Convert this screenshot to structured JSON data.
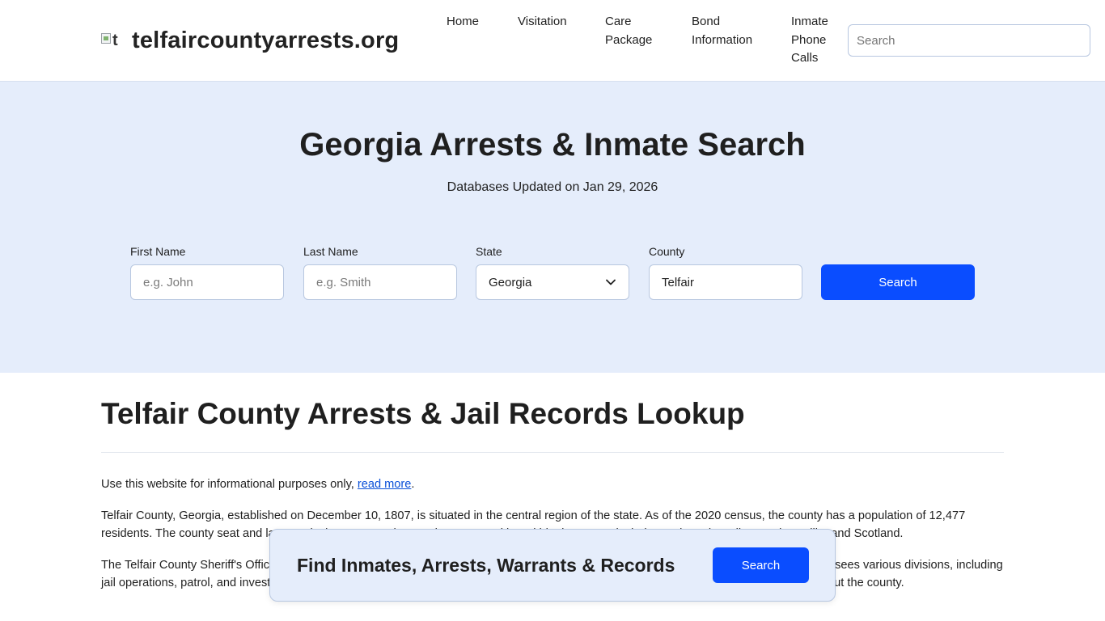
{
  "header": {
    "logo_alt": "t",
    "site_name": "telfaircountyarrests.org",
    "nav": [
      {
        "label": "Home"
      },
      {
        "label": "Visitation"
      },
      {
        "label": "Care Package"
      },
      {
        "label": "Bond Information"
      },
      {
        "label": "Inmate Phone Calls"
      }
    ],
    "search_placeholder": "Search"
  },
  "hero": {
    "title": "Georgia Arrests & Inmate Search",
    "subtitle": "Databases Updated on Jan 29, 2026",
    "fields": {
      "first_name": {
        "label": "First Name",
        "placeholder": "e.g. John"
      },
      "last_name": {
        "label": "Last Name",
        "placeholder": "e.g. Smith"
      },
      "state": {
        "label": "State",
        "value": "Georgia"
      },
      "county": {
        "label": "County",
        "value": "Telfair"
      }
    },
    "search_button": "Search"
  },
  "content": {
    "title": "Telfair County Arrests & Jail Records Lookup",
    "p1_text": "Use this website for informational purposes only, ",
    "p1_link": "read more",
    "p1_end": ".",
    "p2": "Telfair County, Georgia, established on December 10, 1807, is situated in the central region of the state. As of the 2020 census, the county has a population of 12,477 residents. The county seat and largest city is McRae-Helena. Other communities within the county include Lumber City, Milan, Jacksonville, and Scotland.",
    "p3": "The Telfair County Sheriff's Office is the primary law enforcement agency serving the county's residents and visitors. The Sheriff's Office oversees various divisions, including jail operations, patrol, and investigations, working closely with local and state agencies to maintain public safety and uphold the law throughout the county."
  },
  "floating_bar": {
    "title": "Find Inmates, Arrests, Warrants & Records",
    "button": "Search"
  },
  "colors": {
    "accent": "#0a4dff",
    "hero_bg": "#e5edfb",
    "link": "#0a50d8"
  }
}
